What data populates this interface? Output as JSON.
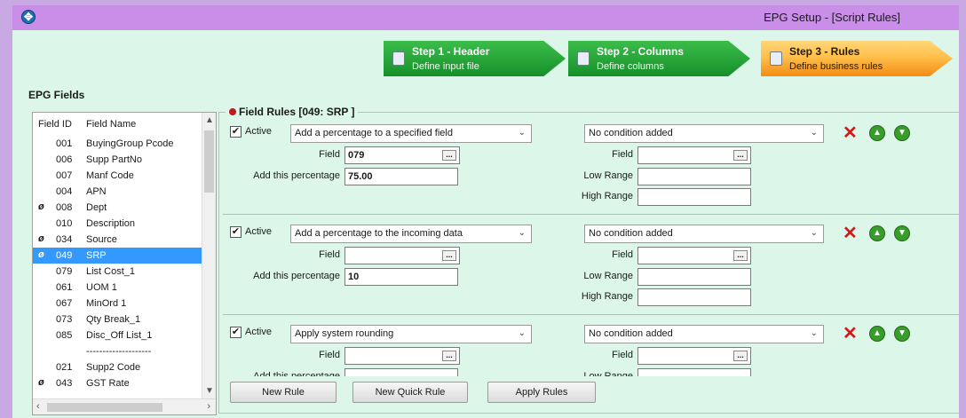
{
  "window": {
    "title": "EPG Setup - [Script Rules]"
  },
  "steps": [
    {
      "title": "Step 1 - Header",
      "subtitle": "Define input file"
    },
    {
      "title": "Step 2 - Columns",
      "subtitle": "Define columns"
    },
    {
      "title": "Step 3 - Rules",
      "subtitle": "Define business rules"
    }
  ],
  "epg_fields": {
    "label": "EPG Fields",
    "col_id": "Field ID",
    "col_name": "Field Name",
    "rows": [
      {
        "mark": "",
        "id": "001",
        "name": "BuyingGroup Pcode"
      },
      {
        "mark": "",
        "id": "006",
        "name": "Supp PartNo"
      },
      {
        "mark": "",
        "id": "007",
        "name": "Manf Code"
      },
      {
        "mark": "",
        "id": "004",
        "name": "APN"
      },
      {
        "mark": "ø",
        "id": "008",
        "name": "Dept"
      },
      {
        "mark": "",
        "id": "010",
        "name": "Description"
      },
      {
        "mark": "ø",
        "id": "034",
        "name": "Source"
      },
      {
        "mark": "ø",
        "id": "049",
        "name": "SRP"
      },
      {
        "mark": "",
        "id": "079",
        "name": "List Cost_1"
      },
      {
        "mark": "",
        "id": "061",
        "name": "UOM 1"
      },
      {
        "mark": "",
        "id": "067",
        "name": "MinOrd 1"
      },
      {
        "mark": "",
        "id": "073",
        "name": "Qty Break_1"
      },
      {
        "mark": "",
        "id": "085",
        "name": "Disc_Off List_1"
      },
      {
        "mark": "",
        "id": "",
        "name": "--------------------"
      },
      {
        "mark": "",
        "id": "021",
        "name": "Supp2 Code"
      },
      {
        "mark": "ø",
        "id": "043",
        "name": "GST Rate"
      }
    ]
  },
  "field_rules": {
    "title": "Field Rules [049: SRP ]",
    "active_label": "Active",
    "field_label": "Field",
    "pct_label": "Add this percentage",
    "low_label": "Low Range",
    "high_label": "High Range",
    "rules": [
      {
        "action": "Add a percentage to a specified field",
        "field": "079",
        "percentage": "75.00",
        "condition": "No condition added"
      },
      {
        "action": "Add a percentage to the incoming data",
        "field": "",
        "percentage": "10",
        "condition": "No condition added"
      },
      {
        "action": "Apply system rounding",
        "field": "",
        "percentage": "",
        "condition": "No condition added"
      }
    ]
  },
  "buttons": {
    "new_rule": "New Rule",
    "new_quick_rule": "New Quick Rule",
    "apply_rules": "Apply Rules"
  }
}
